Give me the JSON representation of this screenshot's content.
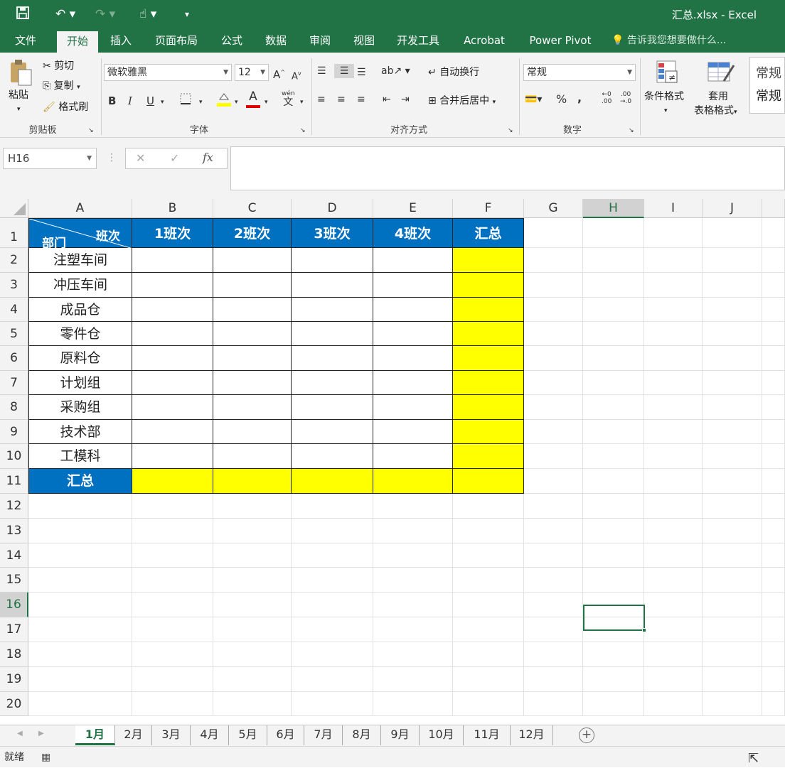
{
  "window": {
    "title": "汇总.xlsx - Excel"
  },
  "quick_access": {
    "save_icon": "save-icon",
    "undo_icon": "undo-icon",
    "redo_icon": "redo-icon",
    "touch_icon": "touch-mode-icon",
    "customize": "customize-icon"
  },
  "ribbon_tabs": [
    {
      "label": "文件"
    },
    {
      "label": "开始",
      "active": true
    },
    {
      "label": "插入"
    },
    {
      "label": "页面布局"
    },
    {
      "label": "公式"
    },
    {
      "label": "数据"
    },
    {
      "label": "审阅"
    },
    {
      "label": "视图"
    },
    {
      "label": "开发工具"
    },
    {
      "label": "Acrobat"
    },
    {
      "label": "Power Pivot"
    }
  ],
  "tell_me": "告诉我您想要做什么...",
  "clipboard": {
    "paste": "粘贴",
    "cut": "剪切",
    "copy": "复制",
    "format_painter": "格式刷",
    "group": "剪贴板"
  },
  "font": {
    "name": "微软雅黑",
    "size": "12",
    "bold": "B",
    "italic": "I",
    "underline": "U",
    "font_color_glyph": "A",
    "fill_color": "#ffff00",
    "text_color": "#e00000",
    "group": "字体",
    "grow": "A",
    "shrink": "A",
    "wen": "wén"
  },
  "alignment": {
    "wrap": "自动换行",
    "merge": "合并后居中",
    "group": "对齐方式"
  },
  "number": {
    "format": "常规",
    "percent": "%",
    "comma": ",",
    "group": "数字"
  },
  "styles": {
    "conditional": "条件格式",
    "table_format_1": "套用",
    "table_format_2": "表格格式",
    "style_1": "常规",
    "style_2": "常规"
  },
  "formula_bar": {
    "name_box": "H16",
    "fx": "fx",
    "cancel": "✕",
    "confirm": "✓",
    "value": ""
  },
  "columns": [
    "A",
    "B",
    "C",
    "D",
    "E",
    "F",
    "G",
    "H",
    "I",
    "J"
  ],
  "selected_column": "H",
  "rows": [
    "1",
    "2",
    "3",
    "4",
    "5",
    "6",
    "7",
    "8",
    "9",
    "10",
    "11",
    "12",
    "13",
    "14",
    "15",
    "16",
    "17",
    "18",
    "19",
    "20"
  ],
  "selected_row": "16",
  "table": {
    "corner_top": "班次",
    "corner_bottom": "部门",
    "headers": [
      "1班次",
      "2班次",
      "3班次",
      "4班次",
      "汇总"
    ],
    "departments": [
      "注塑车间",
      "冲压车间",
      "成品仓",
      "零件仓",
      "原料仓",
      "计划组",
      "采购组",
      "技术部",
      "工模科"
    ],
    "total_label": "汇总",
    "header_color": "#0070c0",
    "total_color": "#ffff00"
  },
  "sheet_tabs": [
    "1月",
    "2月",
    "3月",
    "4月",
    "5月",
    "6月",
    "7月",
    "8月",
    "9月",
    "10月",
    "11月",
    "12月"
  ],
  "active_sheet": "1月",
  "status": {
    "text": "就绪"
  },
  "colors": {
    "accent": "#217346"
  }
}
